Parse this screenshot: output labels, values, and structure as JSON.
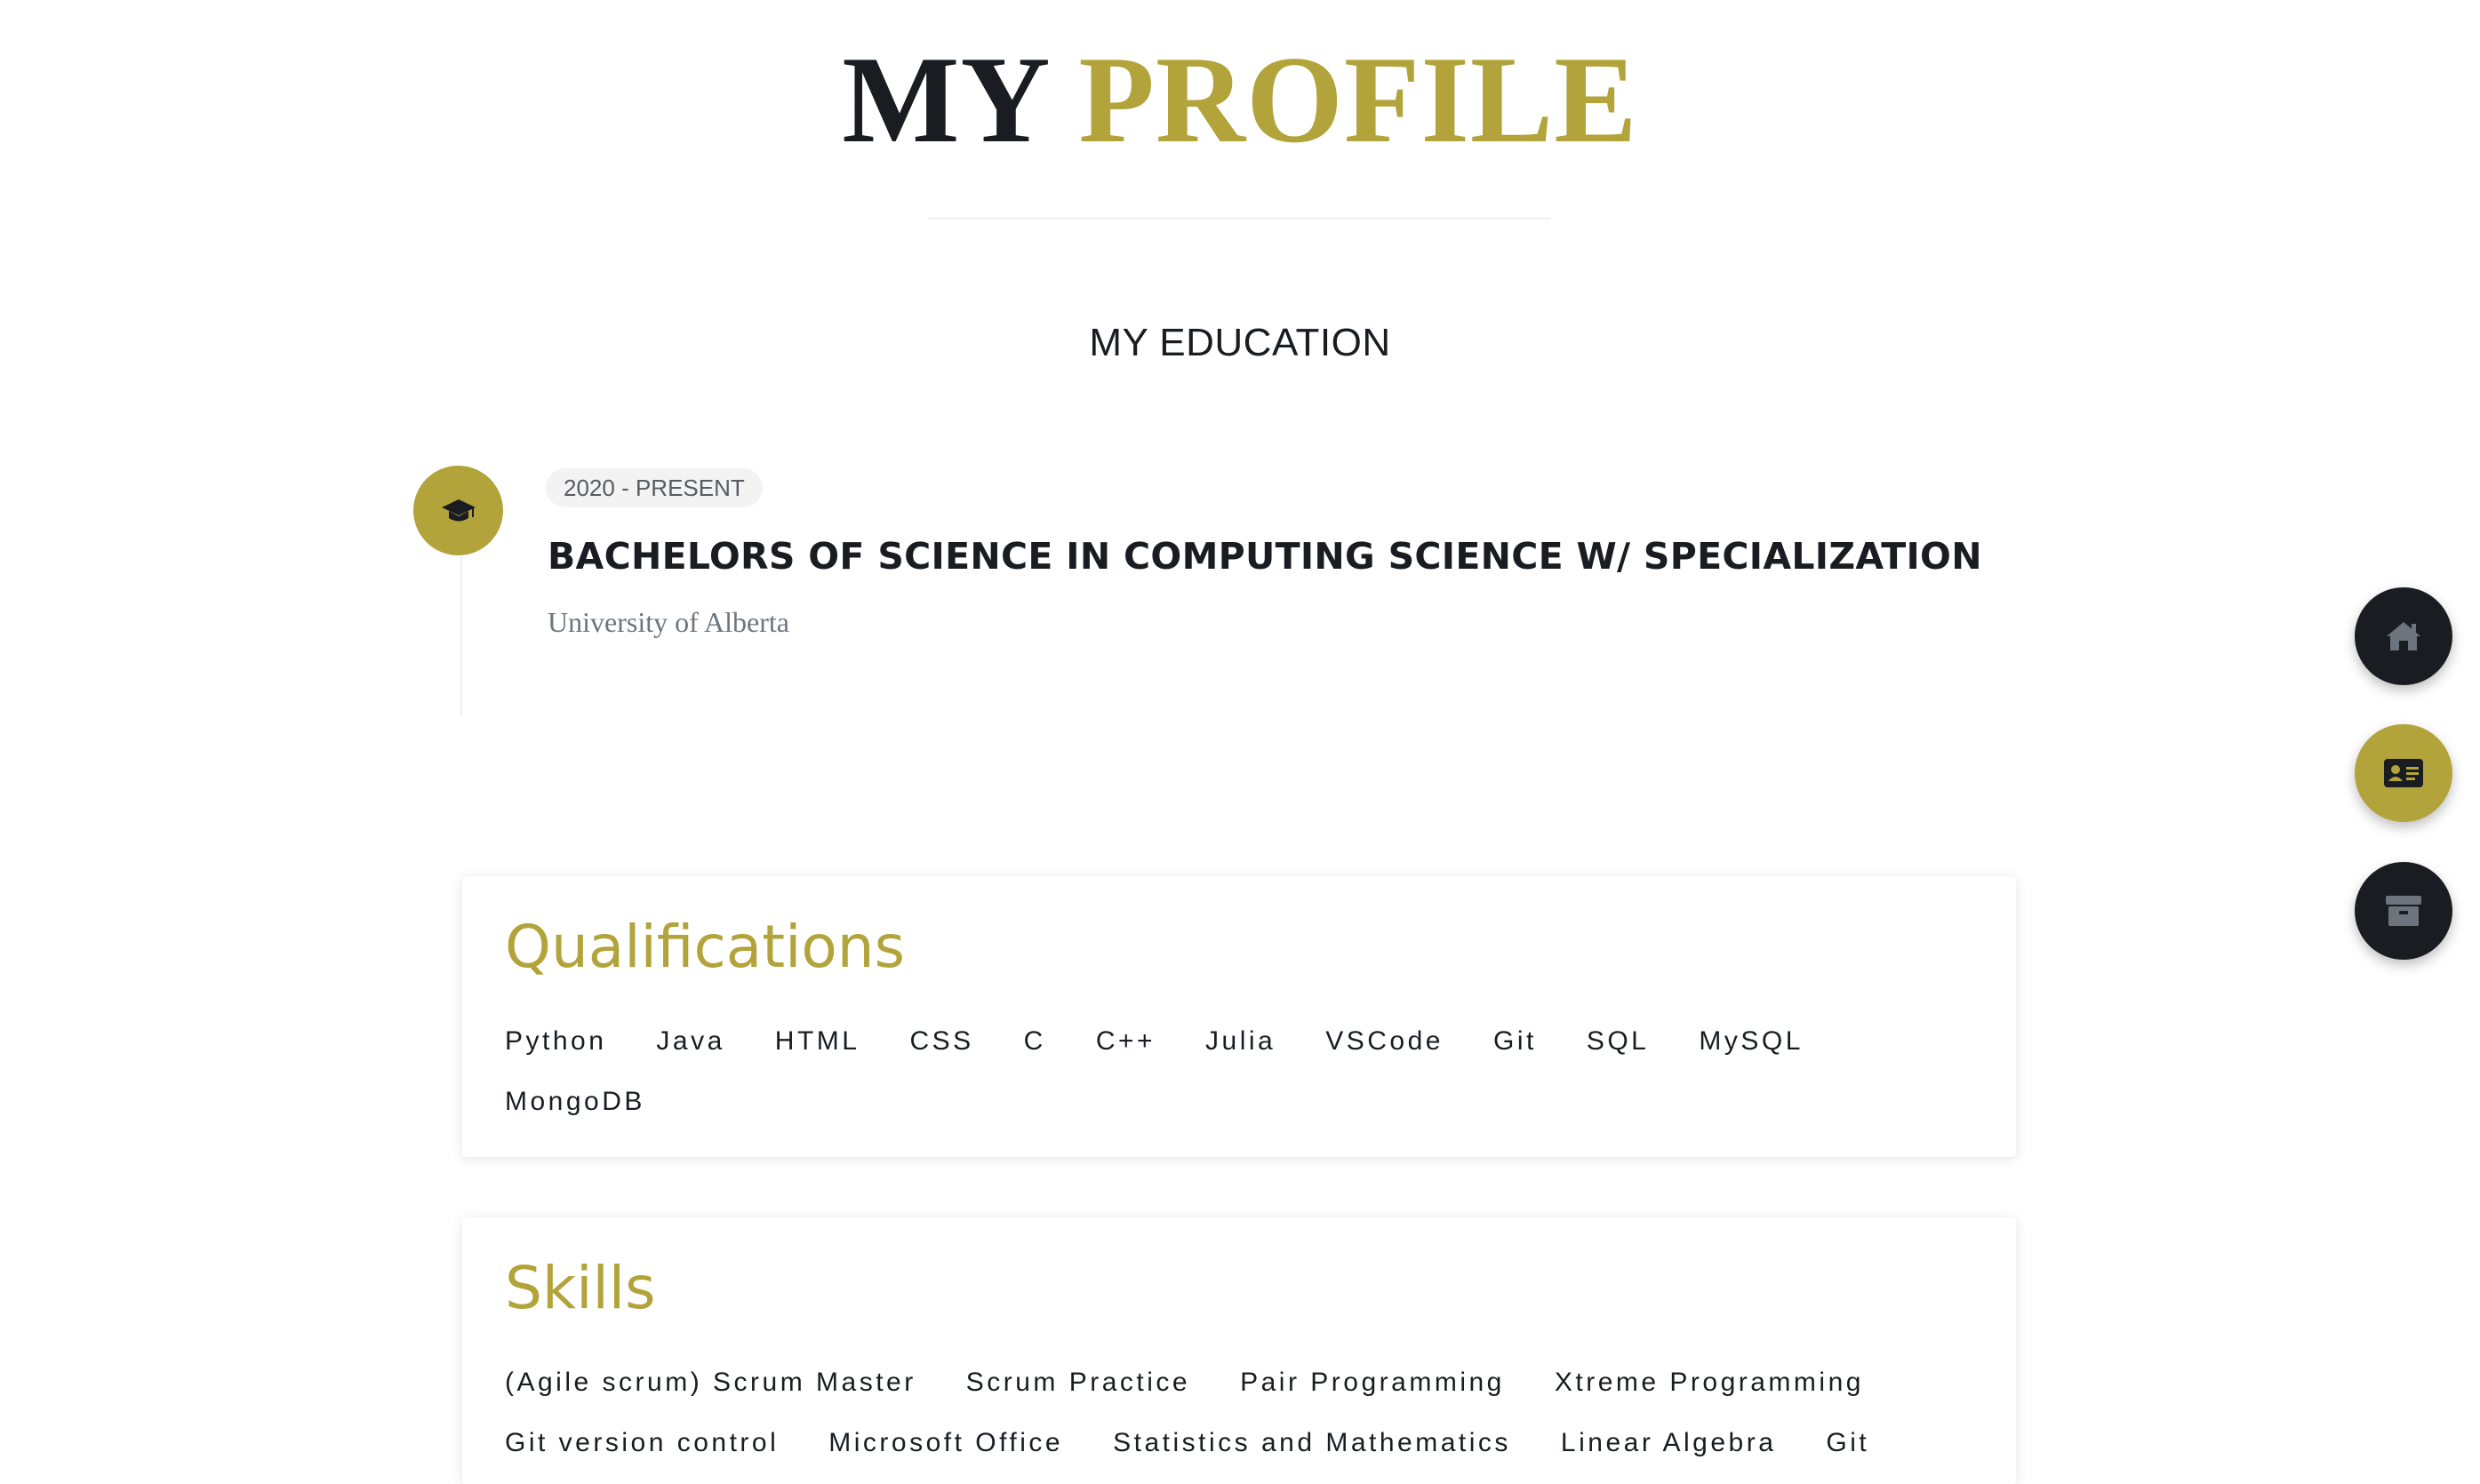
{
  "header": {
    "title_part1": "MY",
    "title_part2": "PROFILE",
    "title_part1_color": "#191d21",
    "title_part2_color": "#b2a33a"
  },
  "education": {
    "section_title": "MY EDUCATION",
    "items": [
      {
        "icon": "graduation-cap-icon",
        "date": "2020 - PRESENT",
        "degree": "BACHELORS OF SCIENCE IN COMPUTING SCIENCE W/ SPECIALIZATION",
        "school": "University of Alberta"
      }
    ]
  },
  "qualifications": {
    "title": "Qualifications",
    "items": [
      "Python",
      "Java",
      "HTML",
      "CSS",
      "C",
      "C++",
      "Julia",
      "VSCode",
      "Git",
      "SQL",
      "MySQL",
      "MongoDB"
    ]
  },
  "skills": {
    "title": "Skills",
    "items": [
      "(Agile scrum) Scrum Master",
      "Scrum Practice",
      "Pair Programming",
      "Xtreme Programming",
      "Git version control",
      "Microsoft Office",
      "Statistics and Mathematics",
      "Linear Algebra",
      "Git"
    ]
  },
  "floating_nav": [
    {
      "icon": "home-icon",
      "active": false
    },
    {
      "icon": "id-card-icon",
      "active": true
    },
    {
      "icon": "archive-box-icon",
      "active": false
    }
  ],
  "colors": {
    "accent": "#b2a33a",
    "dark": "#191d21",
    "muted": "#6c757d"
  }
}
